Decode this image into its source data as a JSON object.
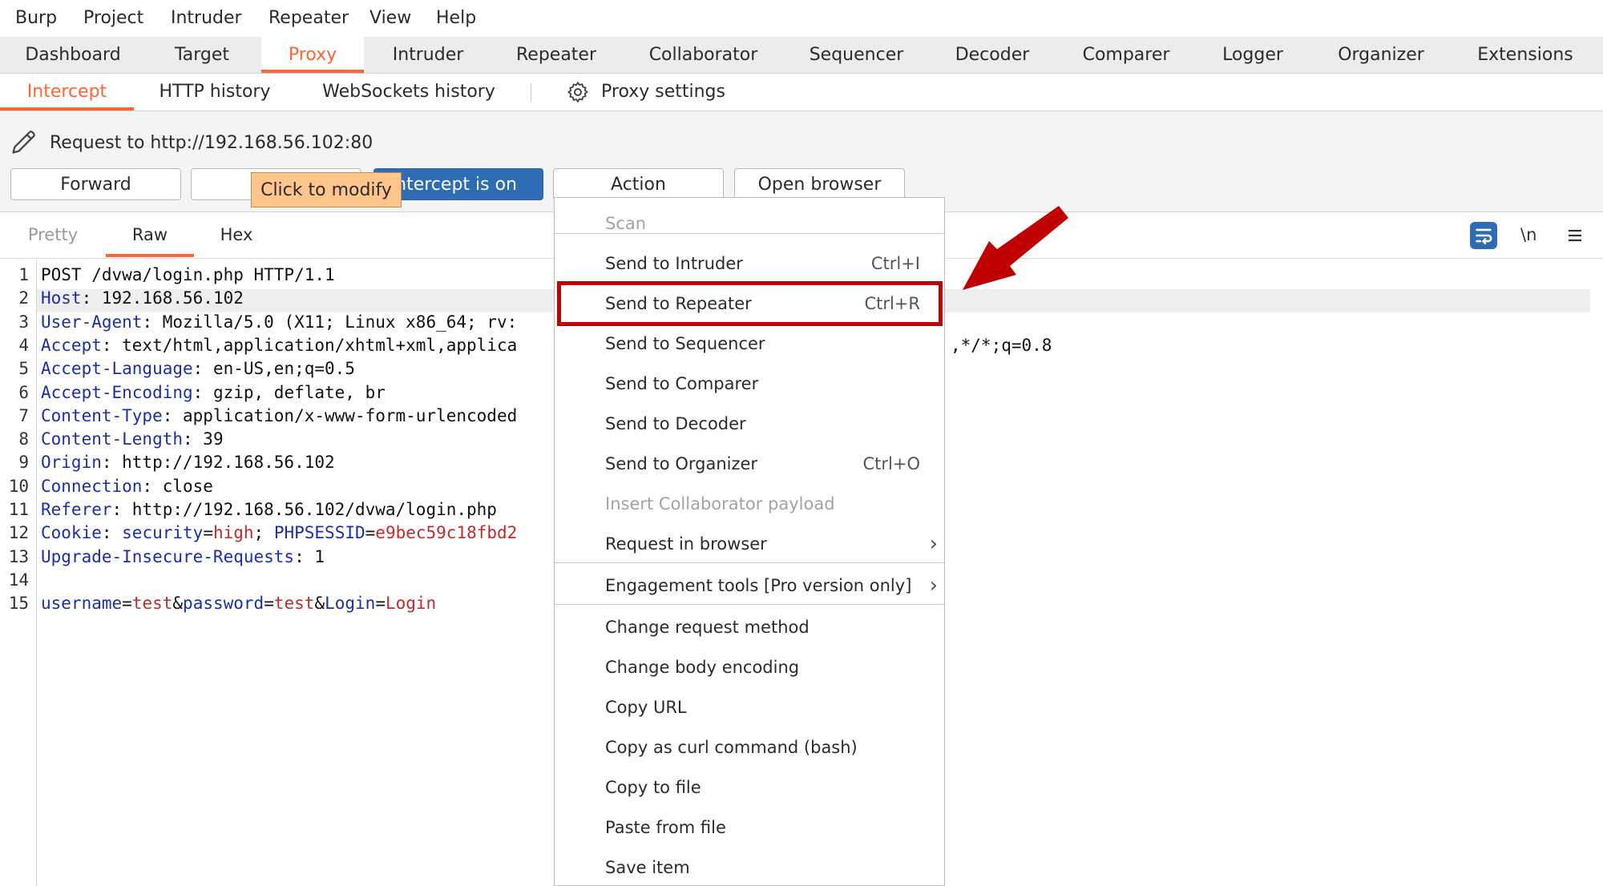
{
  "menubar": [
    "Burp",
    "Project",
    "Intruder",
    "Repeater",
    "View",
    "Help"
  ],
  "main_tabs": [
    "Dashboard",
    "Target",
    "Proxy",
    "Intruder",
    "Repeater",
    "Collaborator",
    "Sequencer",
    "Decoder",
    "Comparer",
    "Logger",
    "Organizer",
    "Extensions"
  ],
  "sub_tabs": {
    "intercept": "Intercept",
    "http_history": "HTTP history",
    "websockets_history": "WebSockets history",
    "proxy_settings": "Proxy settings"
  },
  "request": {
    "title": "Request to http://192.168.56.102:80"
  },
  "buttons": {
    "forward": "Forward",
    "intercept_state": "ntercept is on",
    "tooltip": "Click to modify",
    "action": "Action",
    "open_browser": "Open browser"
  },
  "editor_tabs": [
    "Pretty",
    "Raw",
    "Hex"
  ],
  "editor_tools": {
    "newline_toggle": "\\n"
  },
  "request_lines": [
    {
      "n": "1",
      "k": "",
      "v": "POST /dvwa/login.php HTTP/1.1"
    },
    {
      "n": "2",
      "k": "Host",
      "v": ": 192.168.56.102"
    },
    {
      "n": "3",
      "k": "User-Agent",
      "v": ": Mozilla/5.0 (X11; Linux x86_64; rv:"
    },
    {
      "n": "4",
      "k": "Accept",
      "v": ": text/html,application/xhtml+xml,applica"
    },
    {
      "n": "5",
      "k": "Accept-Language",
      "v": ": en-US,en;q=0.5"
    },
    {
      "n": "6",
      "k": "Accept-Encoding",
      "v": ": gzip, deflate, br"
    },
    {
      "n": "7",
      "k": "Content-Type",
      "v": ": application/x-www-form-urlencoded"
    },
    {
      "n": "8",
      "k": "Content-Length",
      "v": ": 39"
    },
    {
      "n": "9",
      "k": "Origin",
      "v": ": http://192.168.56.102"
    },
    {
      "n": "10",
      "k": "Connection",
      "v": ": close"
    },
    {
      "n": "11",
      "k": "Referer",
      "v": ": http://192.168.56.102/dvwa/login.php"
    },
    {
      "n": "12",
      "k": "Cookie",
      "v": ": "
    },
    {
      "n": "13",
      "k": "Upgrade-Insecure-Requests",
      "v": ": 1"
    },
    {
      "n": "14",
      "k": "",
      "v": ""
    },
    {
      "n": "15",
      "k": "",
      "v": ""
    }
  ],
  "accept_tail": ",*/*;q=0.8",
  "cookie": {
    "k1": "security",
    "eq1": "=",
    "v1": "high",
    "sep": "; ",
    "k2": "PHPSESSID",
    "eq2": "=",
    "v2": "e9bec59c18fbd2"
  },
  "body": {
    "k1": "username",
    "eq1": "=",
    "v1": "test",
    "amp1": "&",
    "k2": "password",
    "eq2": "=",
    "v2": "test",
    "amp2": "&",
    "k3": "Login",
    "eq3": "=",
    "v3": "Login"
  },
  "context_menu": {
    "items": [
      {
        "label": "Scan",
        "shortcut": "",
        "disabled": true
      },
      {
        "label": "Send to Intruder",
        "shortcut": "Ctrl+I"
      },
      {
        "label": "Send to Repeater",
        "shortcut": "Ctrl+R",
        "highlighted": true
      },
      {
        "label": "Send to Sequencer",
        "shortcut": ""
      },
      {
        "label": "Send to Comparer",
        "shortcut": ""
      },
      {
        "label": "Send to Decoder",
        "shortcut": ""
      },
      {
        "label": "Send to Organizer",
        "shortcut": "Ctrl+O"
      },
      {
        "label": "Insert Collaborator payload",
        "shortcut": "",
        "disabled": true
      },
      {
        "label": "Request in browser",
        "shortcut": "",
        "submenu": true
      },
      {
        "label": "Engagement tools [Pro version only]",
        "shortcut": "",
        "submenu": true
      },
      {
        "label": "Change request method",
        "shortcut": ""
      },
      {
        "label": "Change body encoding",
        "shortcut": ""
      },
      {
        "label": "Copy URL",
        "shortcut": ""
      },
      {
        "label": "Copy as curl command (bash)",
        "shortcut": ""
      },
      {
        "label": "Copy to file",
        "shortcut": ""
      },
      {
        "label": "Paste from file",
        "shortcut": ""
      },
      {
        "label": "Save item",
        "shortcut": ""
      }
    ]
  },
  "colors": {
    "accent": "#ff6633",
    "intercept_blue": "#2e6db5",
    "annotation_red": "#c00000",
    "tooltip": "#ffc58a",
    "header_key": "#1a2fa8",
    "value_red": "#c32b2b"
  },
  "icons": [
    "pencil-icon",
    "gear-icon",
    "wrap-lines-icon",
    "hamburger-icon",
    "chevron-right-icon",
    "annotation-arrow"
  ]
}
